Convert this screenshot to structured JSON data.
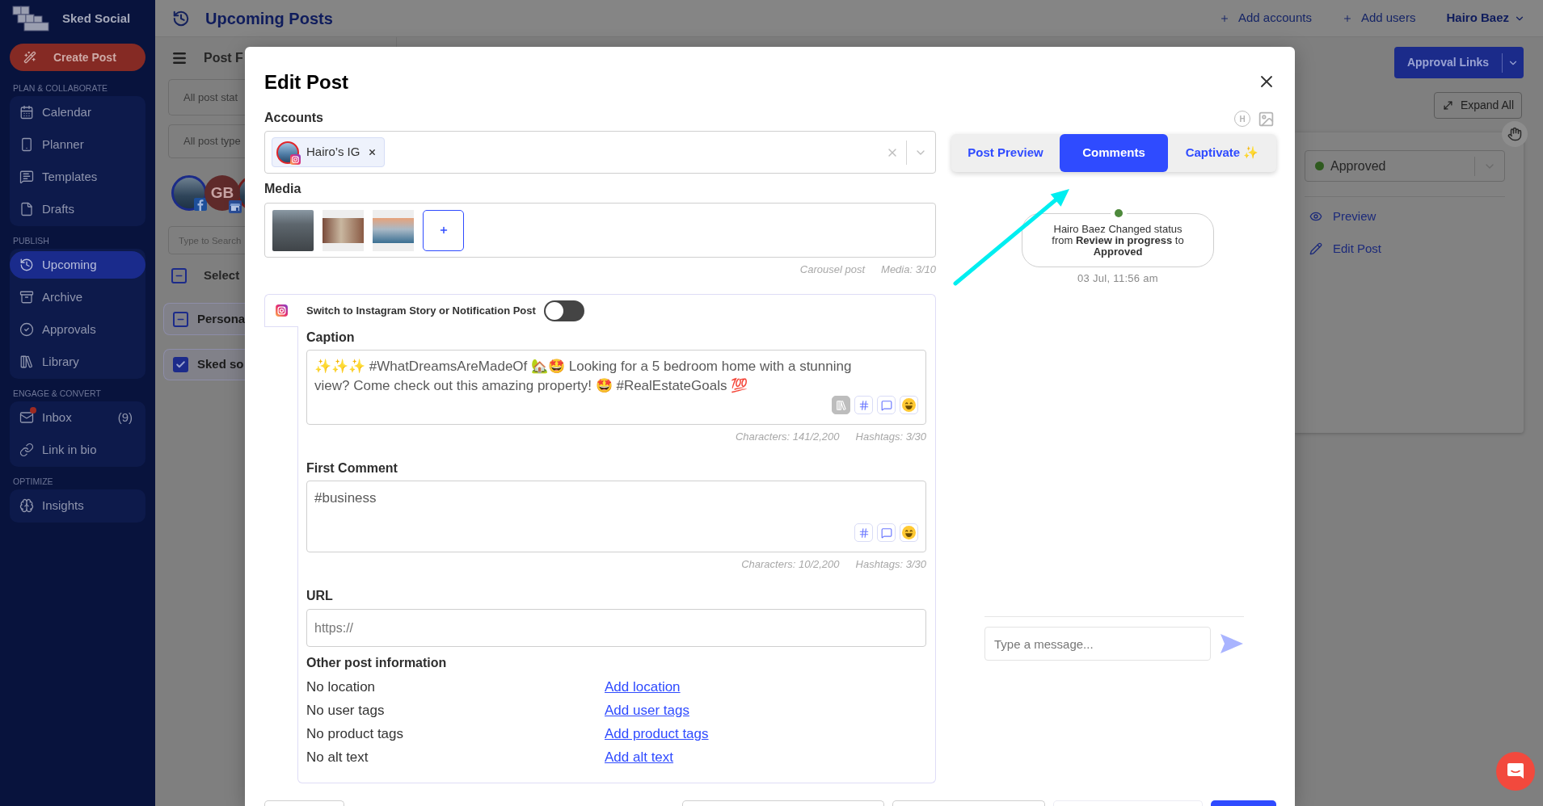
{
  "sidebar": {
    "brand": "Sked Social",
    "create_post": "Create Post",
    "sections": [
      {
        "title": "PLAN & COLLABORATE",
        "items": [
          {
            "label": "Calendar",
            "selected": false,
            "alert": false
          },
          {
            "label": "Planner",
            "selected": false,
            "alert": false
          },
          {
            "label": "Templates",
            "selected": false,
            "alert": false
          },
          {
            "label": "Drafts",
            "selected": false,
            "alert": false
          }
        ]
      },
      {
        "title": "PUBLISH",
        "items": [
          {
            "label": "Upcoming",
            "selected": true,
            "alert": false
          },
          {
            "label": "Archive",
            "selected": false,
            "alert": false
          },
          {
            "label": "Approvals",
            "selected": false,
            "alert": false
          },
          {
            "label": "Library",
            "selected": false,
            "alert": false
          }
        ]
      },
      {
        "title": "ENGAGE & CONVERT",
        "items": [
          {
            "label": "Inbox",
            "count": "(9)",
            "selected": false,
            "alert": true
          },
          {
            "label": "Link in bio",
            "selected": false,
            "alert": false
          }
        ]
      },
      {
        "title": "OPTIMIZE",
        "items": [
          {
            "label": "Insights",
            "selected": false,
            "alert": false
          }
        ]
      }
    ]
  },
  "top_bar": {
    "title": "Upcoming Posts",
    "actions": [
      "Add accounts",
      "Add users"
    ],
    "user": "Hairo Baez"
  },
  "posts_panel": {
    "title": "Post F",
    "filters": [
      "All post stat",
      "All post type"
    ],
    "avatars": [
      {
        "kind": "photo"
      },
      {
        "kind": "initials",
        "initials": "GB"
      },
      {
        "kind": "photo"
      }
    ],
    "search": {
      "placeholder": "Type to Search"
    },
    "select_all": {
      "label": "Select",
      "checked": false,
      "partial": true
    },
    "groups": [
      {
        "label": "Persona",
        "checked": false,
        "partial": true
      },
      {
        "label": "Sked so",
        "checked": true,
        "partial": false
      }
    ]
  },
  "approvals_panel": {
    "approval_links": "Approval Links",
    "expand_all": "Expand All",
    "status": "Approved",
    "actions": [
      "Preview",
      "Edit Post"
    ]
  },
  "edit_post": {
    "title": "Edit Post",
    "accounts": {
      "label": "Accounts",
      "chips": [
        "Hairo’s IG"
      ]
    },
    "media": {
      "label": "Media",
      "items": [
        {
          "kind": "cover"
        },
        {
          "kind": "letterbox"
        },
        {
          "kind": "letterbox"
        }
      ],
      "notes": [
        "Carousel post",
        "Media: 3/10"
      ]
    },
    "story_switch": {
      "label": "Switch to Instagram Story or Notification Post",
      "on": false
    },
    "caption": {
      "label": "Caption",
      "value": "✨✨✨ #WhatDreamsAreMadeOf 🏡🤩 Looking for a 5 bedroom home with a stunning view? Come check out this amazing property! 🤩 #RealEstateGoals 💯",
      "tools": [
        {
          "kind": "library",
          "disabled": true
        },
        {
          "kind": "hashtag",
          "disabled": false
        },
        {
          "kind": "comment",
          "disabled": false
        },
        {
          "kind": "emoji",
          "disabled": false
        }
      ],
      "stats": [
        "Characters: 141/2,200",
        "Hashtags: 3/30"
      ]
    },
    "first_comment": {
      "label": "First Comment",
      "value": "#business",
      "tools": [
        {
          "kind": "hashtag",
          "disabled": false
        },
        {
          "kind": "comment",
          "disabled": false
        },
        {
          "kind": "emoji",
          "disabled": false
        }
      ],
      "stats": [
        "Characters: 10/2,200",
        "Hashtags: 3/30"
      ]
    },
    "url": {
      "label": "URL",
      "placeholder": "https://"
    },
    "other_info": {
      "title": "Other post information",
      "rows": [
        {
          "status": "No location",
          "link": "Add location"
        },
        {
          "status": "No user tags",
          "link": "Add user tags"
        },
        {
          "status": "No product tags",
          "link": "Add product tags"
        },
        {
          "status": "No alt text",
          "link": "Add alt text"
        }
      ]
    },
    "footer_buttons": [
      {
        "kind": "outline"
      },
      {
        "kind": "outline"
      },
      {
        "kind": "outline"
      },
      {
        "kind": "faint"
      },
      {
        "kind": "primary"
      }
    ],
    "side_panel": {
      "header_badge": "H",
      "tabs": [
        {
          "label": "Post Preview",
          "selected": false
        },
        {
          "label": "Comments",
          "selected": true
        },
        {
          "label": "Captivate ✨",
          "selected": false
        }
      ],
      "activity": [
        {
          "text": "Hairo Baez Changed status from **Review in progress** to **Approved**",
          "time": "03 Jul, 11:56 am"
        }
      ],
      "message": {
        "placeholder": "Type a message..."
      }
    }
  }
}
